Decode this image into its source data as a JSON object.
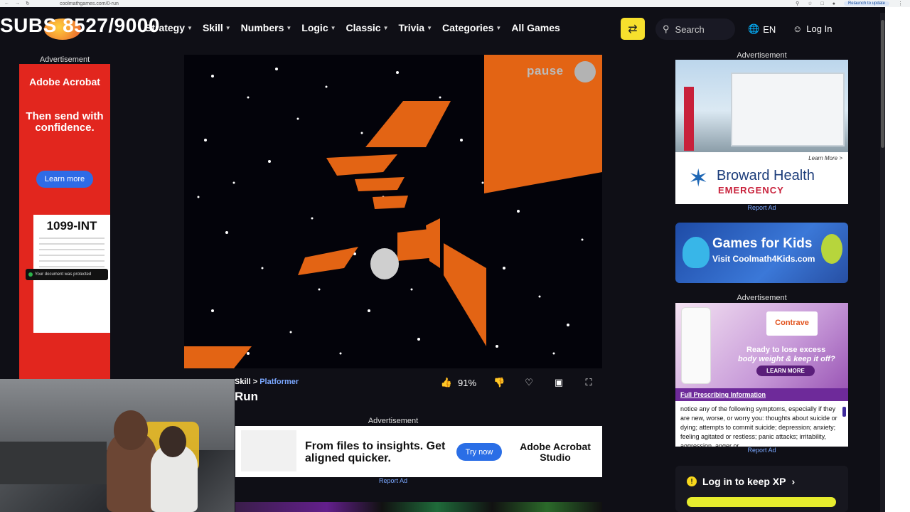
{
  "browser": {
    "url": "coolmathgames.com/0-run",
    "relaunch": "Relaunch to update"
  },
  "overlay": {
    "subs": "SUBS 8527/9000"
  },
  "nav": {
    "items": [
      {
        "label": "Strategy"
      },
      {
        "label": "Skill"
      },
      {
        "label": "Numbers"
      },
      {
        "label": "Logic"
      },
      {
        "label": "Classic"
      },
      {
        "label": "Trivia"
      },
      {
        "label": "Categories"
      },
      {
        "label": "All Games"
      }
    ],
    "search_placeholder": "Search",
    "language": "EN",
    "login": "Log In"
  },
  "left_ad": {
    "label": "Advertisement",
    "brand": "Adobe Acrobat",
    "tagline": "Then send with confidence.",
    "cta": "Learn more",
    "doc_title": "1099-INT",
    "toast": "Your document was protected"
  },
  "game": {
    "pause": "pause",
    "breadcrumb_cat": "Skill",
    "breadcrumb_sep": ">",
    "breadcrumb_sub": "Platformer",
    "title": "Run",
    "rating": "91%"
  },
  "bottom_ad": {
    "label": "Advertisement",
    "headline": "From files to insights. Get aligned quicker.",
    "cta": "Try now",
    "brand": "Adobe Acrobat Studio",
    "report": "Report Ad"
  },
  "right_ads": {
    "label1": "Advertisement",
    "broward_learn": "Learn More >",
    "broward_name": "Broward Health",
    "broward_sub": "EMERGENCY",
    "report1": "Report Ad",
    "kids_title": "Games for Kids",
    "kids_sub": "Visit Coolmath4Kids.com",
    "label2": "Advertisement",
    "contrave_logo": "Contrave",
    "contrave_h1": "Ready to lose excess",
    "contrave_h2": "body weight & keep it off?",
    "contrave_cta": "LEARN MORE",
    "contrave_bar": "Full Prescribing Information",
    "contrave_body": "notice any of the following symptoms, especially if they are new, worse, or worry you: thoughts about suicide or dying; attempts to commit suicide; depression; anxiety; feeling agitated or restless; panic attacks; irritability, aggression, anger or",
    "report2": "Report Ad",
    "xp_text": "Log in to keep XP"
  },
  "colors": {
    "accent_yellow": "#f7e02d",
    "link_blue": "#7aa7ff",
    "game_orange": "#e36414"
  },
  "icons": [
    "shuffle-icon",
    "search-icon",
    "globe-icon",
    "user-icon",
    "thumbs-up-icon",
    "thumbs-down-icon",
    "heart-icon",
    "screenshot-icon",
    "fullscreen-icon",
    "chevron-down-icon"
  ]
}
